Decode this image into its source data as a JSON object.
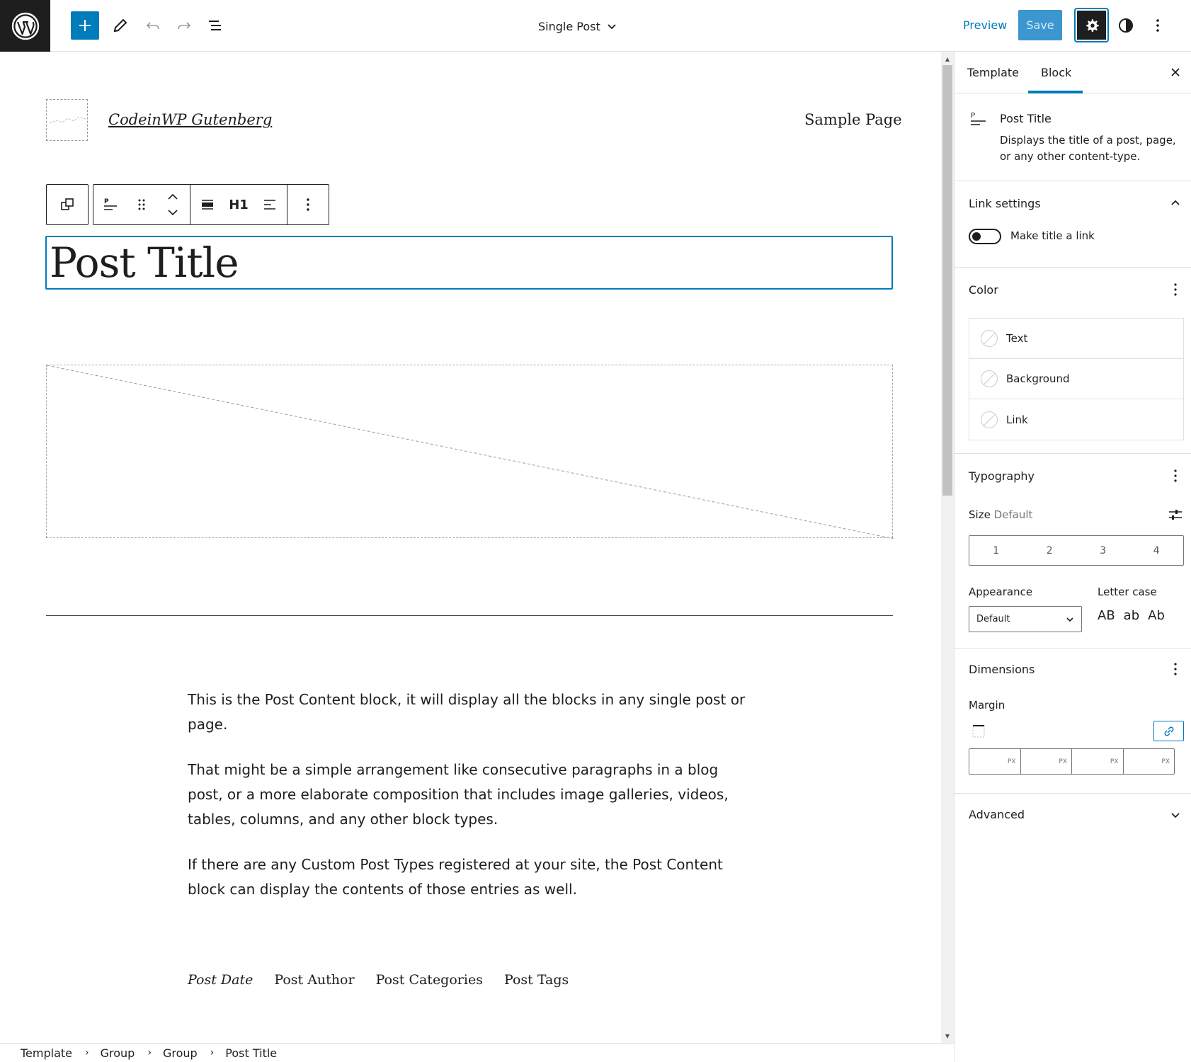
{
  "topbar": {
    "document_title": "Single Post",
    "preview_label": "Preview",
    "save_label": "Save"
  },
  "site": {
    "title": "CodeinWP Gutenberg",
    "nav_link": "Sample Page"
  },
  "block_toolbar": {
    "heading_level": "H1"
  },
  "post": {
    "title": "Post Title",
    "content": [
      "This is the Post Content block, it will display all the blocks in any single post or page.",
      "That might be a simple arrangement like consecutive paragraphs in a blog post, or a more elaborate composition that includes image galleries, videos, tables, columns, and any other block types.",
      "If there are any Custom Post Types registered at your site, the Post Content block can display the contents of those entries as well."
    ],
    "meta": [
      "Post Date",
      "Post Author",
      "Post Categories",
      "Post Tags"
    ]
  },
  "breadcrumb": [
    "Template",
    "Group",
    "Group",
    "Post Title"
  ],
  "sidebar": {
    "tabs": [
      "Template",
      "Block"
    ],
    "active_tab": "Block",
    "block": {
      "name": "Post Title",
      "description": "Displays the title of a post, page, or any other content-type."
    },
    "link_settings": {
      "title": "Link settings",
      "toggle_label": "Make title a link"
    },
    "color": {
      "title": "Color",
      "items": [
        "Text",
        "Background",
        "Link"
      ]
    },
    "typography": {
      "title": "Typography",
      "size_label": "Size",
      "size_value": "Default",
      "size_options": [
        "1",
        "2",
        "3",
        "4"
      ],
      "appearance_label": "Appearance",
      "appearance_value": "Default",
      "letter_case_label": "Letter case",
      "letter_case_options": [
        "AB",
        "ab",
        "Ab"
      ]
    },
    "dimensions": {
      "title": "Dimensions",
      "margin_label": "Margin",
      "unit": "PX"
    },
    "advanced": {
      "title": "Advanced"
    }
  },
  "colors": {
    "accent": "#007cba",
    "dark": "#1e1e1e"
  }
}
